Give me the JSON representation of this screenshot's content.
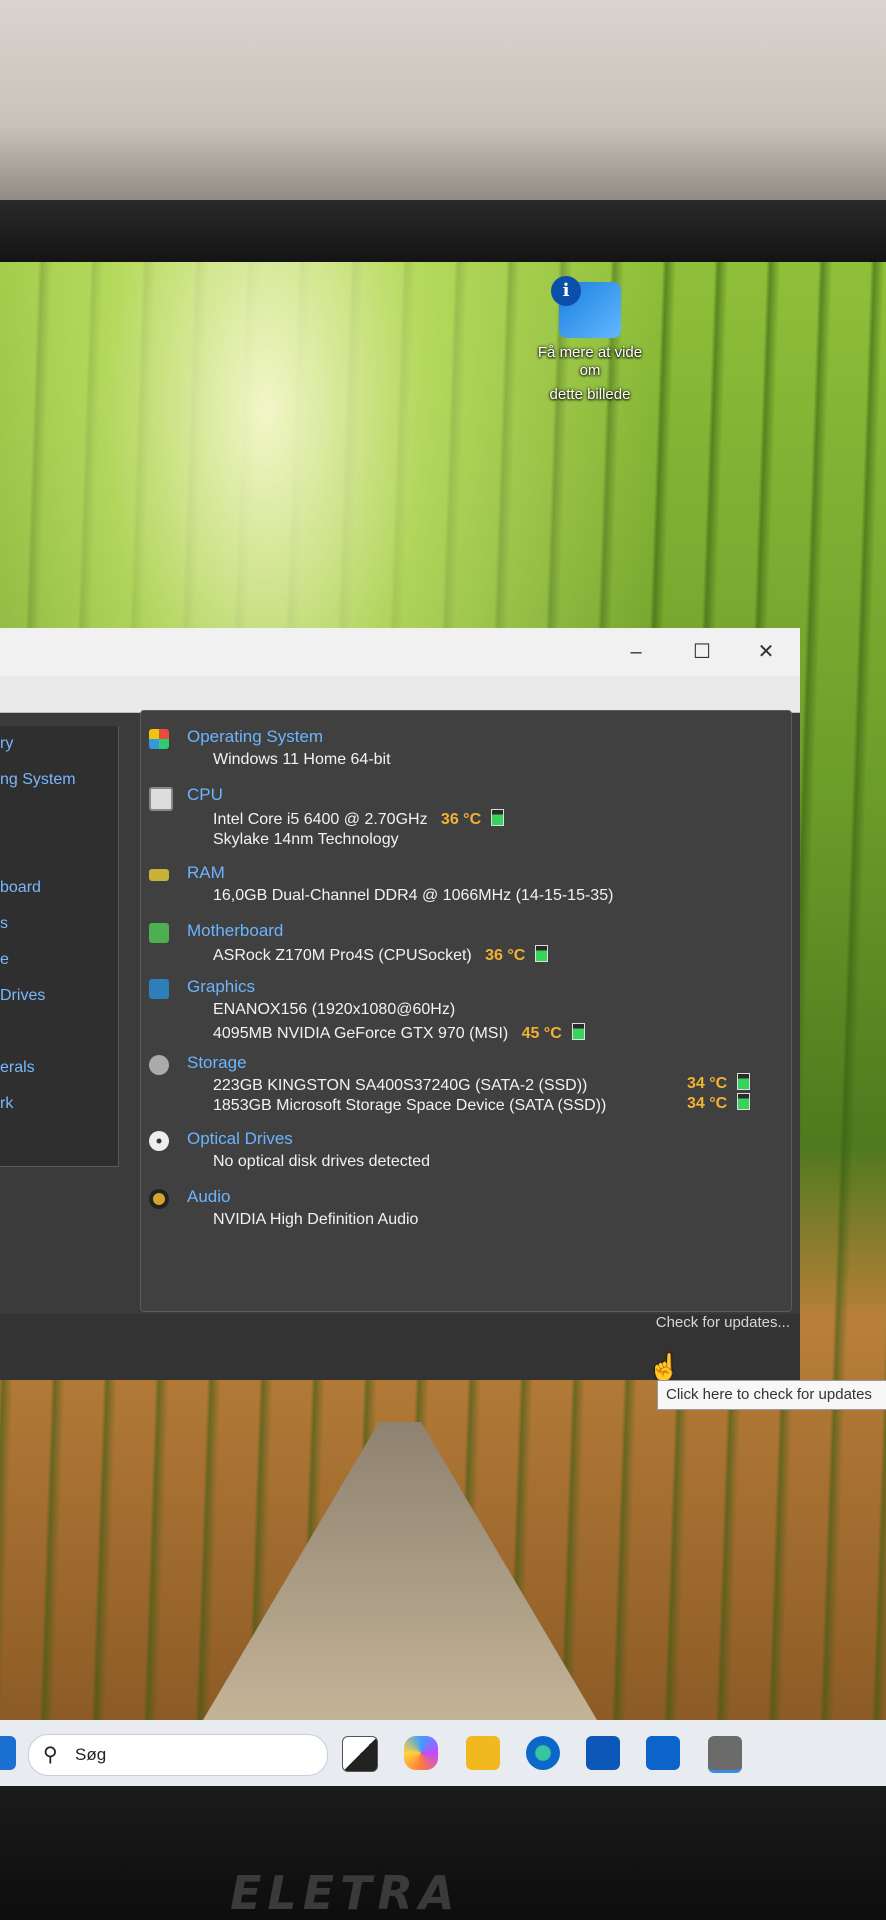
{
  "desktop_icon": {
    "label_line1": "Få mere at vide om",
    "label_line2": "dette billede"
  },
  "window": {
    "sidebar": [
      "ry",
      "ng System",
      "",
      "",
      "board",
      "s",
      "e",
      " Drives",
      "",
      "erals",
      "rk"
    ],
    "sections": [
      {
        "heading": "Operating System",
        "lines": [
          "Windows 11 Home 64-bit"
        ]
      },
      {
        "heading": "CPU",
        "lines": [
          "Intel Core i5 6400 @ 2.70GHz",
          "Skylake 14nm Technology"
        ],
        "temp": "36 °C"
      },
      {
        "heading": "RAM",
        "lines": [
          "16,0GB Dual-Channel DDR4 @ 1066MHz (14-15-15-35)"
        ]
      },
      {
        "heading": "Motherboard",
        "lines": [
          "ASRock Z170M Pro4S (CPUSocket)"
        ],
        "temp": "36 °C"
      },
      {
        "heading": "Graphics",
        "lines": [
          "ENANOX156 (1920x1080@60Hz)",
          "4095MB NVIDIA GeForce GTX 970 (MSI)"
        ],
        "temp": "45 °C"
      },
      {
        "heading": "Storage",
        "lines": [
          "223GB KINGSTON SA400S37240G (SATA-2 (SSD))",
          "1853GB Microsoft Storage Space Device (SATA (SSD))"
        ],
        "temps": [
          "34 °C",
          "34 °C"
        ]
      },
      {
        "heading": "Optical Drives",
        "lines": [
          "No optical disk drives detected"
        ]
      },
      {
        "heading": "Audio",
        "lines": [
          "NVIDIA High Definition Audio"
        ]
      }
    ],
    "check_updates": "Check for updates...",
    "tooltip": "Click here to check for updates"
  },
  "taskbar": {
    "search_label": "Søg",
    "icons": [
      "start-icon",
      "task-view-icon",
      "copilot-icon",
      "file-explorer-icon",
      "edge-icon",
      "store-icon",
      "outlook-icon",
      "speccy-icon"
    ]
  },
  "monitor_brand": "ELETRA"
}
